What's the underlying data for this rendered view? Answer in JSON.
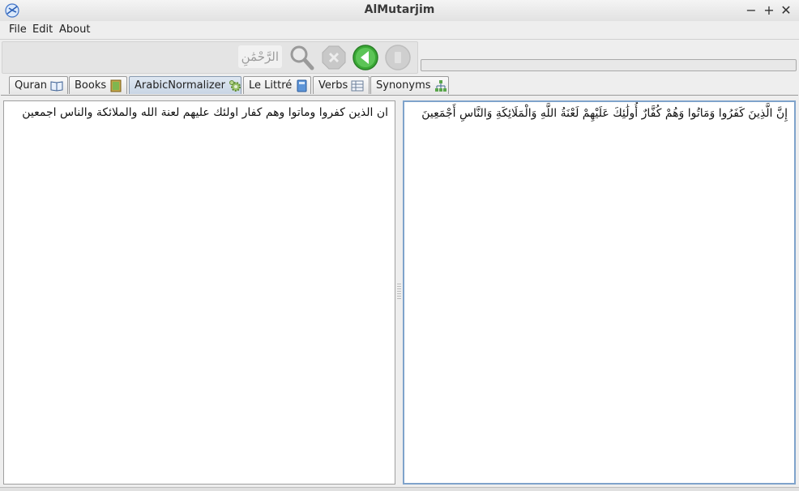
{
  "window": {
    "title": "AlMutarjim",
    "minimize": "−",
    "maximize": "+",
    "close": "✕"
  },
  "menu": {
    "file": "File",
    "edit": "Edit",
    "about": "About"
  },
  "toolbar": {
    "search_value": "الرَّحْمَٰنِ",
    "icons": [
      "search-icon",
      "stop-icon",
      "back-icon",
      "next-icon"
    ],
    "progress_fraction": 0
  },
  "tabs": [
    {
      "label": "Quran",
      "icon": "book-icon"
    },
    {
      "label": "Books",
      "icon": "books-icon"
    },
    {
      "label": "ArabicNormalizer",
      "icon": "gear-icon",
      "active": true
    },
    {
      "label": "Le Littré",
      "icon": "dictionary-icon"
    },
    {
      "label": "Verbs",
      "icon": "table-icon"
    },
    {
      "label": "Synonyms",
      "icon": "tree-icon"
    }
  ],
  "panes": {
    "left_text": "ان الذين كفروا وماتوا وهم كفار اولئك عليهم لعنة الله والملائكة والناس اجمعين",
    "right_text": "إِنَّ الَّذِينَ كَفَرُوا وَمَاتُوا وَهُمْ كُفَّارٌ أُولَٰئِكَ عَلَيْهِمْ لَعْنَةُ اللَّهِ وَالْمَلَائِكَةِ وَالنَّاسِ أَجْمَعِينَ"
  },
  "colors": {
    "accent": "#7fa3cb",
    "back_button": "#3aa835"
  }
}
